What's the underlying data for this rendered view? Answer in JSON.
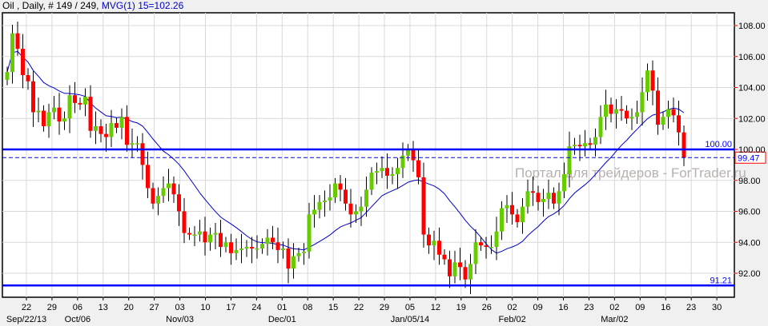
{
  "header": {
    "title": "Oil , Daily, # 149 / 249,",
    "indicator": "MVG(1) 15=102.26"
  },
  "watermark": "Портал для трейдеров - ForTrader.ru",
  "colors": {
    "up": "#66cc00",
    "down": "#ff0000",
    "ma": "#0000c8",
    "level": "#0000ff",
    "grid": "#d8d8d8"
  },
  "chart_data": {
    "type": "candlestick",
    "symbol": "Oil",
    "timeframe": "Daily",
    "ylim": [
      91.0,
      108.8
    ],
    "yticks": [
      "92.00",
      "94.00",
      "96.00",
      "98.00",
      "100.00",
      "102.00",
      "104.00",
      "106.00",
      "108.00"
    ],
    "x_day_ticks": [
      "22",
      "29",
      "06",
      "13",
      "20",
      "27",
      "03",
      "10",
      "17",
      "24",
      "01",
      "08",
      "15",
      "22",
      "29",
      "05",
      "12",
      "19",
      "26",
      "02",
      "09",
      "16",
      "23",
      "02",
      "09",
      "16",
      "23",
      "30"
    ],
    "x_month_labels": [
      {
        "label": "Sep/22/13",
        "tick": 0
      },
      {
        "label": "Oct/06",
        "tick": 2
      },
      {
        "label": "Nov/03",
        "tick": 6
      },
      {
        "label": "Dec/01",
        "tick": 10
      },
      {
        "label": "Jan/05/14",
        "tick": 15
      },
      {
        "label": "Feb/02",
        "tick": 19
      },
      {
        "label": "Mar/02",
        "tick": 23
      }
    ],
    "first_open": 104.5,
    "closes": [
      105,
      107.5,
      106.5,
      104.8,
      104.4,
      102.4,
      102.5,
      101.5,
      102.4,
      102.7,
      101.8,
      102,
      103.5,
      103,
      102.9,
      103.4,
      101.2,
      101.5,
      101,
      100.8,
      101.7,
      101.4,
      102.1,
      100.3,
      100.4,
      100.4,
      99,
      97.5,
      96.5,
      97,
      97.5,
      97.8,
      97.1,
      96,
      94.6,
      94.5,
      94.5,
      94.7,
      94,
      94.5,
      94.6,
      93.7,
      94,
      93.3,
      93.5,
      93.6,
      93.7,
      93.6,
      93.6,
      93.9,
      94.3,
      94,
      93.5,
      93.6,
      92.3,
      93.1,
      93.3,
      93.4,
      95.8,
      96.1,
      96.6,
      96.7,
      96.9,
      97.8,
      97.4,
      96.5,
      95.8,
      96,
      96.3,
      97.4,
      98.5,
      98.6,
      98.8,
      98.3,
      98.4,
      98.8,
      99.6,
      100,
      99.3,
      98.2,
      94.5,
      93.8,
      94.1,
      93.2,
      92.9,
      91.8,
      92.7,
      92.4,
      91.6,
      92.6,
      94,
      93.8,
      93.7,
      93.7,
      94.7,
      96.2,
      96.4,
      95.8,
      95.3,
      96.3,
      97.3,
      97.2,
      96.6,
      96.8,
      97.2,
      96.5,
      97.3,
      98.4,
      100.2,
      100.3,
      100.2,
      100.4,
      100.3,
      100.8,
      102.1,
      102.9,
      102.3,
      102.6,
      102.5,
      102,
      102.1,
      102.4,
      103.7,
      105.1,
      103.8,
      101.6,
      102.1,
      102.6,
      102.2,
      101.1,
      99.47
    ],
    "moving_average": {
      "name": "MVG(1)",
      "period": 15,
      "last_value": 102.26
    },
    "levels": [
      {
        "value": 100.0,
        "label": "100.00",
        "style": "solid"
      },
      {
        "value": 91.21,
        "label": "91.21",
        "style": "solid"
      },
      {
        "value": 99.47,
        "label": "99.47",
        "style": "dashed-current"
      }
    ]
  }
}
